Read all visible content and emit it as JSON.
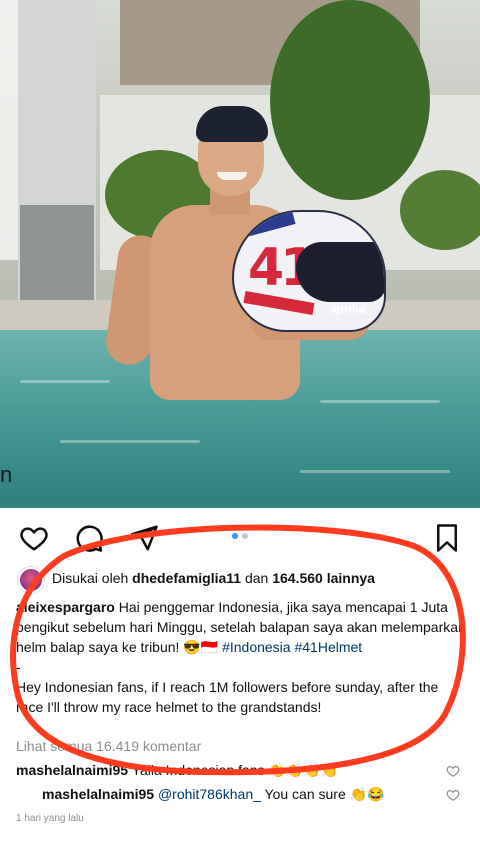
{
  "post": {
    "carousel_fragment": "n",
    "liked_by": {
      "prefix": "Disukai oleh",
      "user": "dhedefamiglia11",
      "middle": "dan",
      "count": "164.560 lainnya"
    },
    "caption": {
      "author": "aleixespargaro",
      "text_id": "Hai penggemar Indonesia, jika saya mencapai 1 Juta pengikut sebelum hari Minggu, setelah balapan saya akan melemparkan helm balap saya ke tribun! 😎🇮🇩",
      "hashtag1": "#Indonesia",
      "hashtag2": "#41Helmet",
      "dash": "-",
      "text_en": "Hey Indonesian fans, if I reach 1M followers before sunday, after the race I'll throw my race helmet to the grandstands!"
    },
    "view_comments": "Lihat semua 16.419 komentar",
    "comments": [
      {
        "user": "mashelalnaimi95",
        "text": "Yalla Indonesian fans 👏👏👏👏"
      },
      {
        "user": "mashelalnaimi95",
        "mention": "@rohit786khan_",
        "text": "You can sure 👏😂"
      }
    ],
    "timestamp": "1 hari yang lalu",
    "carousel": {
      "count": 2,
      "active_index": 0
    },
    "helmet_number": "41",
    "helmet_brand": "aprilia"
  },
  "colors": {
    "link": "#00376b",
    "annotation": "#ff3b1f",
    "muted": "#8e8e8e",
    "dot_active": "#3897f0"
  }
}
